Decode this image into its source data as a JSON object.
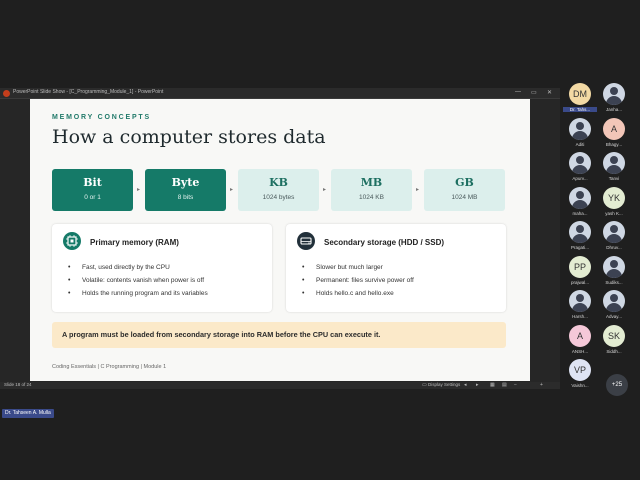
{
  "window": {
    "title": "PowerPoint Slide Show - [C_Programming_Module_1] - PowerPoint",
    "controls": [
      "—",
      "▭",
      "✕"
    ]
  },
  "slide": {
    "eyebrow": "MEMORY CONCEPTS",
    "title": "How a computer stores data",
    "units": [
      {
        "name": "Bit",
        "desc": "0 or 1",
        "style": "dark"
      },
      {
        "name": "Byte",
        "desc": "8 bits",
        "style": "dark"
      },
      {
        "name": "KB",
        "desc": "1024 bytes",
        "style": "light"
      },
      {
        "name": "MB",
        "desc": "1024 KB",
        "style": "light"
      },
      {
        "name": "GB",
        "desc": "1024 MB",
        "style": "light"
      }
    ],
    "arrow_glyph": "▸",
    "primary": {
      "title": "Primary memory (RAM)",
      "items": [
        "Fast, used directly by the CPU",
        "Volatile: contents vanish when power is off",
        "Holds the running program and its variables"
      ]
    },
    "secondary": {
      "title": "Secondary storage (HDD / SSD)",
      "items": [
        "Slower but much larger",
        "Permanent: files survive power off",
        "Holds hello.c and hello.exe"
      ]
    },
    "callout": "A program must be loaded from secondary storage into RAM before the CPU can execute it.",
    "footer": "Coding Essentials  |  C Programming  |  Module 1"
  },
  "statusbar": {
    "slide_counter": "Slide 18 of 24",
    "display_settings": "Display Settings"
  },
  "presenter_label": "Dr. Tahseen A. Mulla",
  "participants": [
    {
      "initials": "DM",
      "name": "Dr. Tahs...",
      "color": "#f3d9a4",
      "photo": false,
      "highlight": true
    },
    {
      "initials": "",
      "name": "Janha...",
      "color": "",
      "photo": true,
      "highlight": false
    },
    {
      "initials": "",
      "name": "Aditi",
      "color": "",
      "photo": true,
      "highlight": false
    },
    {
      "initials": "A",
      "name": "Bhagy...",
      "color": "#f2c6b8",
      "photo": false,
      "highlight": false
    },
    {
      "initials": "",
      "name": "Apurv...",
      "color": "",
      "photo": true,
      "highlight": false
    },
    {
      "initials": "",
      "name": "Tanvi",
      "color": "",
      "photo": true,
      "highlight": false
    },
    {
      "initials": "",
      "name": "maha...",
      "color": "",
      "photo": true,
      "highlight": false
    },
    {
      "initials": "YK",
      "name": "yash K...",
      "color": "#e3ecd2",
      "photo": false,
      "highlight": false
    },
    {
      "initials": "",
      "name": "Pragati...",
      "color": "",
      "photo": true,
      "highlight": false
    },
    {
      "initials": "",
      "name": "Dhruv...",
      "color": "",
      "photo": true,
      "highlight": false
    },
    {
      "initials": "PP",
      "name": "prajwal...",
      "color": "#e3ecd2",
      "photo": false,
      "highlight": false
    },
    {
      "initials": "",
      "name": "Sudiks...",
      "color": "",
      "photo": true,
      "highlight": false
    },
    {
      "initials": "",
      "name": "Harsh...",
      "color": "",
      "photo": true,
      "highlight": false
    },
    {
      "initials": "",
      "name": "Advay...",
      "color": "",
      "photo": true,
      "highlight": false
    },
    {
      "initials": "A",
      "name": "ANSH...",
      "color": "#f5c8d8",
      "photo": false,
      "highlight": false
    },
    {
      "initials": "SK",
      "name": "Siddh...",
      "color": "#e3ecd2",
      "photo": false,
      "highlight": false
    },
    {
      "initials": "VP",
      "name": "Vaishn...",
      "color": "#dfe4f4",
      "photo": false,
      "highlight": false
    }
  ],
  "more_participants": "+25"
}
